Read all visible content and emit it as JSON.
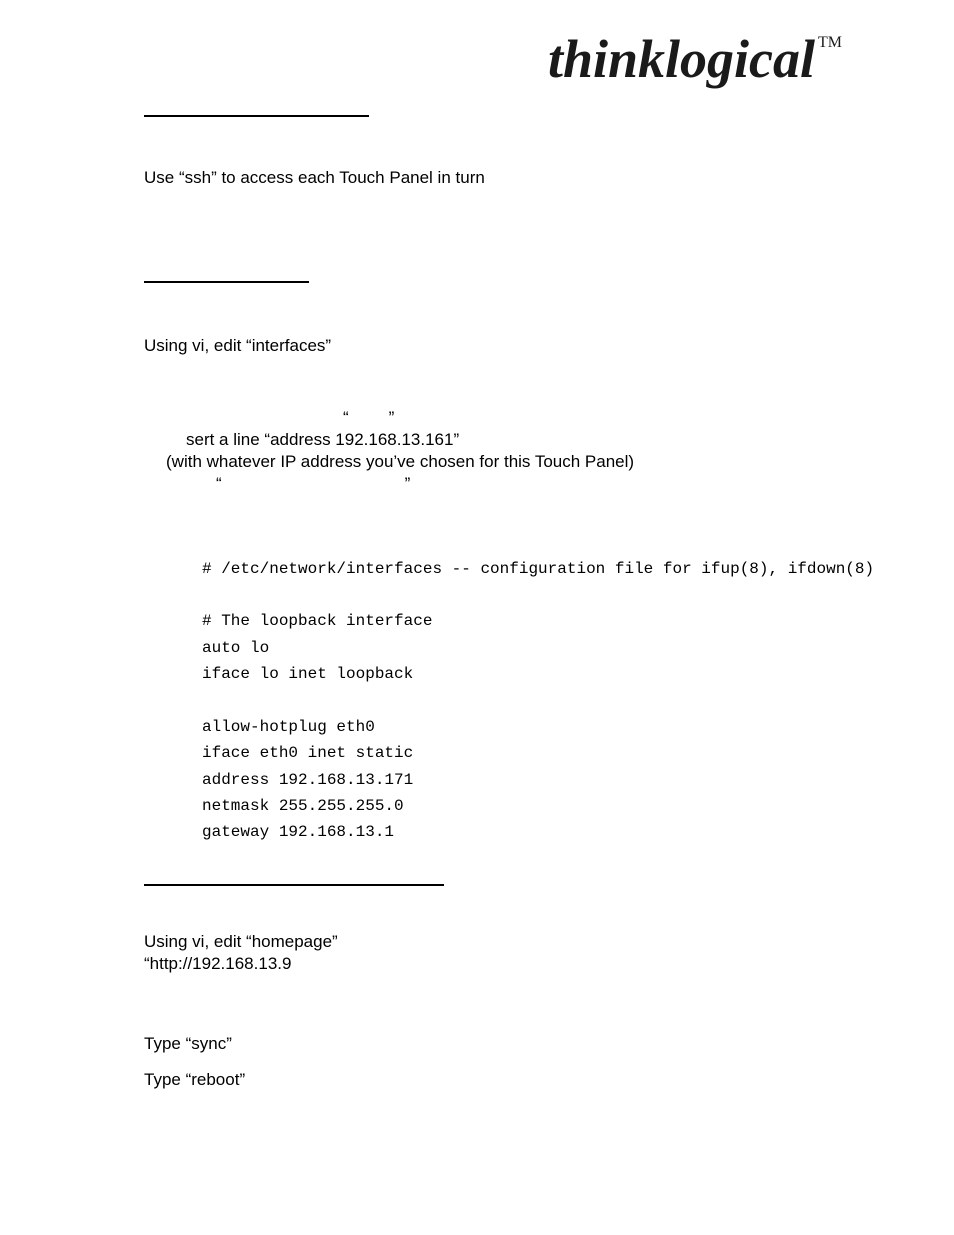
{
  "logo": {
    "text": "thinklogical",
    "tm": "TM"
  },
  "section1": {
    "line1": "Use “ssh” to access each Touch Panel in turn"
  },
  "section2": {
    "line1": "Using vi, edit “interfaces”",
    "quotes1_open": "“",
    "quotes1_close": "”",
    "line2a": "sert a line “address 192.168.13.161”",
    "line2b": "(with whatever IP address you’ve chosen for this Touch Panel)",
    "quotes2_open": "“",
    "quotes2_close": "”"
  },
  "config": {
    "l1": "# /etc/network/interfaces -- configuration file for ifup(8), ifdown(8)",
    "l2": "# The loopback interface",
    "l3": "auto lo",
    "l4": "iface lo inet loopback",
    "l5": "allow-hotplug eth0",
    "l6": "iface eth0 inet static",
    "l7": "address 192.168.13.171",
    "l8": "netmask 255.255.255.0",
    "l9": "gateway 192.168.13.1"
  },
  "section3": {
    "line1": "Using vi, edit “homepage”",
    "line2": "“http://192.168.13.9"
  },
  "section4": {
    "line1": "Type “sync”",
    "line2": "Type “reboot”"
  }
}
